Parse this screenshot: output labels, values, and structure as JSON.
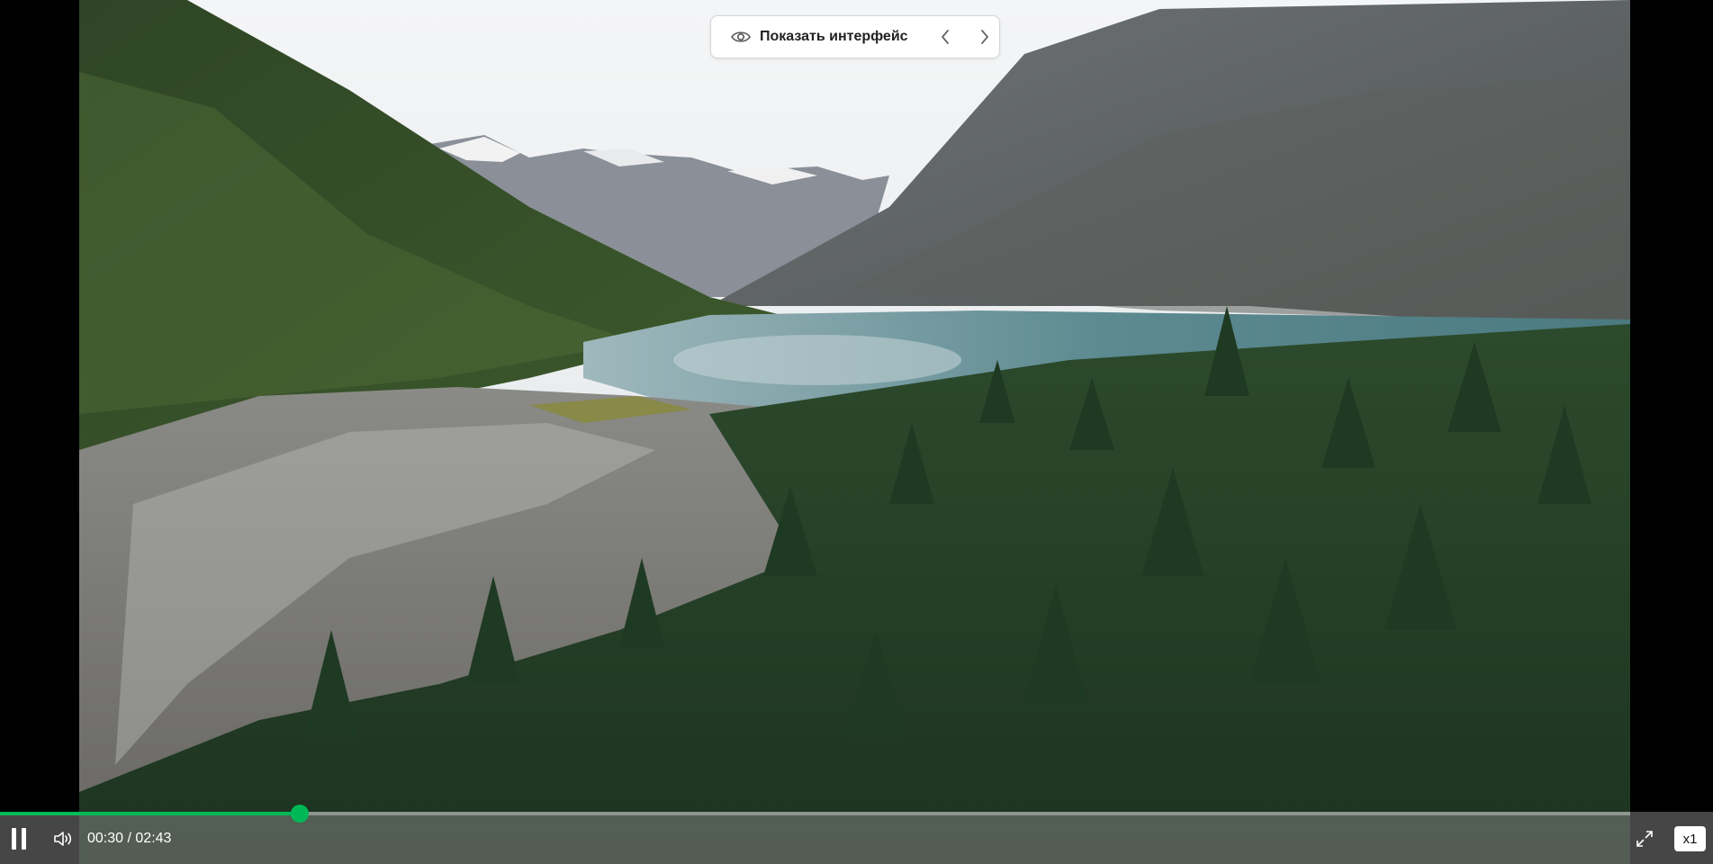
{
  "overlay": {
    "show_ui_label": "Показать интерфейс",
    "eye_icon": "eye-icon",
    "prev_icon": "chevron-left-icon",
    "next_icon": "chevron-right-icon"
  },
  "player": {
    "current_time": "00:30",
    "separator": " / ",
    "duration": "02:43",
    "progress_fraction": 0.184,
    "speed_label": "x1",
    "accent_color": "#00b956",
    "pause_icon": "pause-icon",
    "volume_icon": "volume-icon",
    "fullscreen_icon": "fullscreen-icon"
  }
}
